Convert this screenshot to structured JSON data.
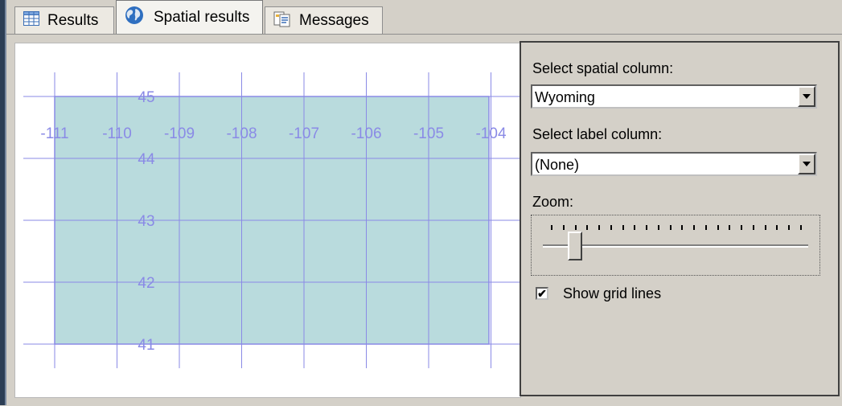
{
  "tabs": [
    {
      "label": "Results",
      "icon": "grid-icon",
      "active": false
    },
    {
      "label": "Spatial results",
      "icon": "globe-icon",
      "active": true
    },
    {
      "label": "Messages",
      "icon": "messages-icon",
      "active": false
    }
  ],
  "settings": {
    "spatial_column_label": "Select spatial column:",
    "spatial_column_value": "Wyoming",
    "label_column_label": "Select label column:",
    "label_column_value": "(None)",
    "zoom_label": "Zoom:",
    "zoom_level_fraction": 0.1,
    "show_grid_lines_label": "Show grid lines",
    "show_grid_lines_checked": true
  },
  "map": {
    "longitude_ticks": [
      "-111",
      "-110",
      "-109",
      "-108",
      "-107",
      "-106",
      "-105",
      "-104"
    ],
    "latitude_ticks": [
      "45",
      "44",
      "43",
      "42",
      "41"
    ],
    "shape_fill": "#b9dbdd",
    "grid_color": "#8a8ae6",
    "label_color": "#8a8ae6"
  }
}
